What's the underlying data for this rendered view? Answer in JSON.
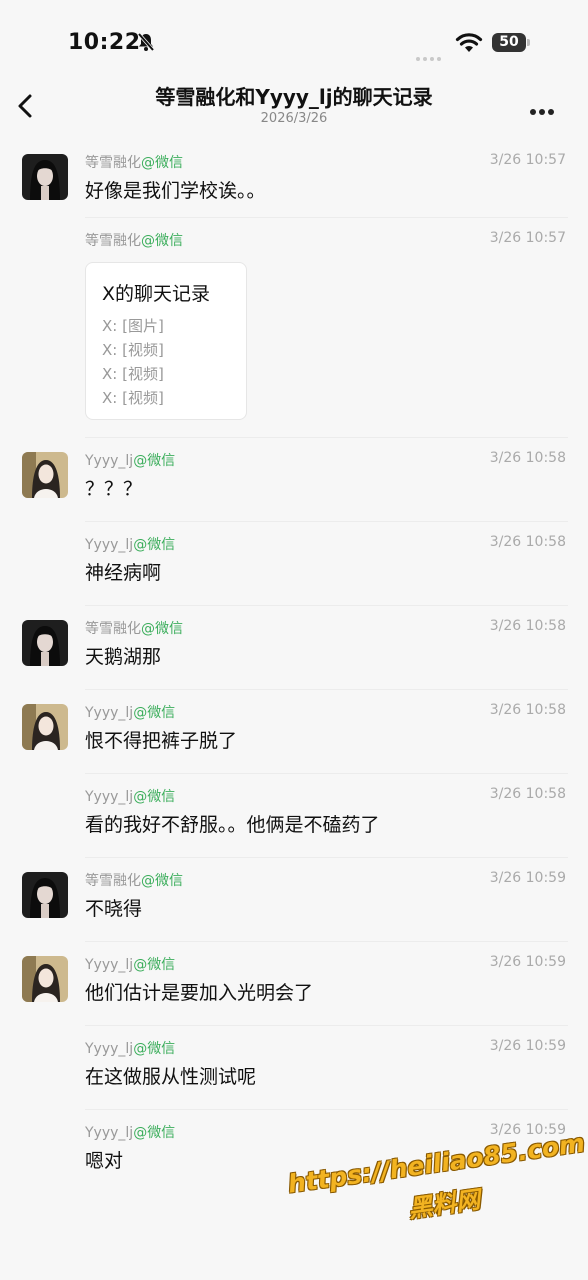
{
  "status_bar": {
    "time": "10:22",
    "battery": "50"
  },
  "header": {
    "title": "等雪融化和Yyyy_lj的聊天记录",
    "date": "2026/3/26"
  },
  "messages": [
    {
      "sender": "等雪融化",
      "app": "@微信",
      "time": "3/26 10:57",
      "text": "好像是我们学校诶。。",
      "avatar": "dark"
    },
    {
      "sender": "等雪融化",
      "app": "@微信",
      "time": "3/26 10:57",
      "text": "",
      "avatar": "none"
    },
    {
      "sender": "Yyyy_lj",
      "app": "@微信",
      "time": "3/26 10:58",
      "text": "？？？",
      "avatar": "light"
    },
    {
      "sender": "Yyyy_lj",
      "app": "@微信",
      "time": "3/26 10:58",
      "text": "神经病啊",
      "avatar": "none"
    },
    {
      "sender": "等雪融化",
      "app": "@微信",
      "time": "3/26 10:58",
      "text": "天鹅湖那",
      "avatar": "dark"
    },
    {
      "sender": "Yyyy_lj",
      "app": "@微信",
      "time": "3/26 10:58",
      "text": "恨不得把裤子脱了",
      "avatar": "light"
    },
    {
      "sender": "Yyyy_lj",
      "app": "@微信",
      "time": "3/26 10:58",
      "text": "看的我好不舒服。。他俩是不磕药了",
      "avatar": "none"
    },
    {
      "sender": "等雪融化",
      "app": "@微信",
      "time": "3/26 10:59",
      "text": "不晓得",
      "avatar": "dark"
    },
    {
      "sender": "Yyyy_lj",
      "app": "@微信",
      "time": "3/26 10:59",
      "text": "他们估计是要加入光明会了",
      "avatar": "light"
    },
    {
      "sender": "Yyyy_lj",
      "app": "@微信",
      "time": "3/26 10:59",
      "text": "在这做服从性测试呢",
      "avatar": "none"
    },
    {
      "sender": "Yyyy_lj",
      "app": "@微信",
      "time": "3/26 10:59",
      "text": "嗯对",
      "avatar": "none"
    }
  ],
  "forward_card": {
    "title": "X的聊天记录",
    "lines": [
      "X: [图片]",
      "X: [视频]",
      "X: [视频]",
      "X: [视频]"
    ]
  },
  "watermark": {
    "url": "https://heiliao85.com",
    "name": "黑料网"
  },
  "colors": {
    "app_tag": "#3cae5c",
    "background": "#f7f7f7",
    "watermark": "#f2b321"
  }
}
